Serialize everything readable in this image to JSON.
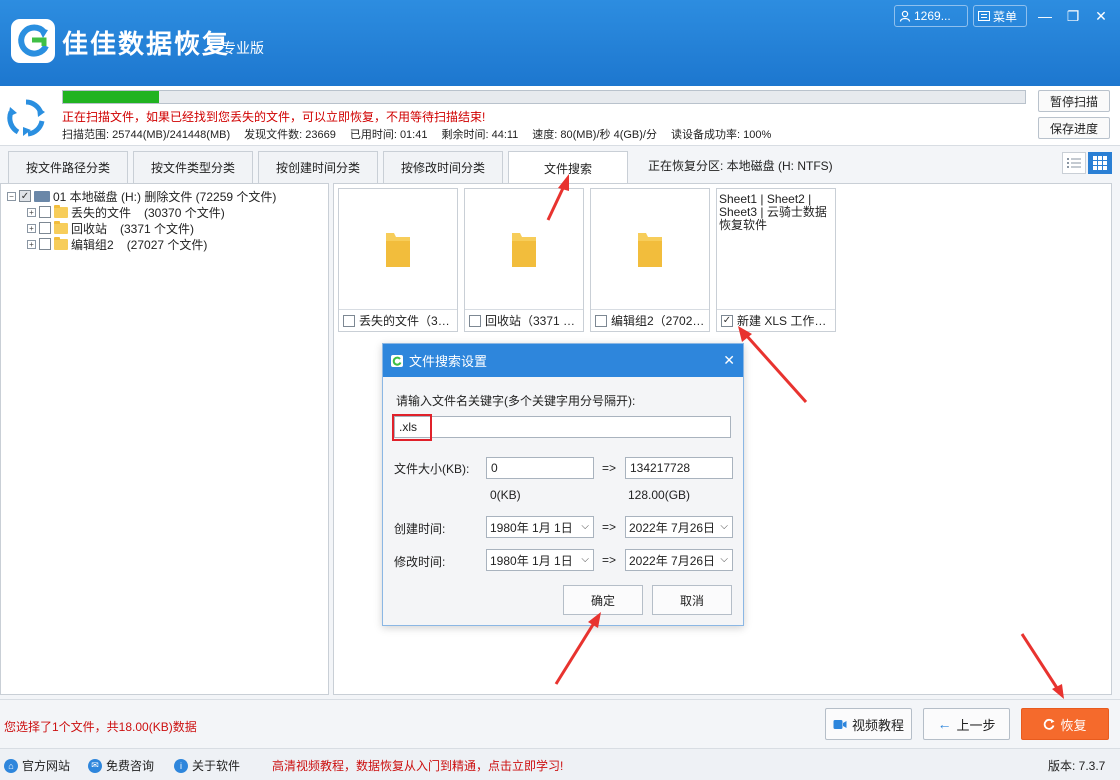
{
  "app": {
    "title": "佳佳数据恢复",
    "edition": "专业版"
  },
  "titlebar": {
    "user": "1269...",
    "menu": "菜单"
  },
  "scan": {
    "progress": 0.1,
    "message": "正在扫描文件，如果已经找到您丢失的文件，可以立即恢复，不用等待扫描结束!",
    "range": "扫描范围: 25744(MB)/241448(MB)",
    "found": "发现文件数: 23669",
    "elapsed": "已用时间: 01:41",
    "remaining": "剩余时间: 44:11",
    "speed": "速度: 80(MB)/秒  4(GB)/分",
    "read_rate": "读设备成功率: 100%",
    "pause_button": "暂停扫描",
    "save_button": "保存进度"
  },
  "tabs": [
    {
      "label": "按文件路径分类"
    },
    {
      "label": "按文件类型分类"
    },
    {
      "label": "按创建时间分类"
    },
    {
      "label": "按修改时间分类"
    },
    {
      "label": "文件搜索"
    }
  ],
  "partition_label": "正在恢复分区: 本地磁盘 (H: NTFS)",
  "tree": {
    "root": "01 本地磁盘 (H:) 删除文件   (72259 个文件)",
    "items": [
      {
        "name": "丢失的文件",
        "count": "(30370 个文件)"
      },
      {
        "name": "回收站",
        "count": "(3371 个文件)"
      },
      {
        "name": "编辑组2",
        "count": "(27027 个文件)"
      }
    ]
  },
  "cards": [
    {
      "label": "丢失的文件（30...",
      "checked": false
    },
    {
      "label": "回收站（3371 个...",
      "checked": false
    },
    {
      "label": "编辑组2（27027 ...",
      "checked": false
    },
    {
      "label": "新建 XLS 工作表...",
      "checked": true,
      "preview": "Sheet1 | Sheet2 | Sheet3 | 云骑士数据恢复软件"
    }
  ],
  "dialog": {
    "title": "文件搜索设置",
    "keyword_label": "请输入文件名关键字(多个关键字用分号隔开):",
    "keyword_value": ".xls",
    "size_label": "文件大小(KB):",
    "size_min": "0",
    "size_max": "134217728",
    "size_min_hint": "0(KB)",
    "size_max_hint": "128.00(GB)",
    "arrow": "=>",
    "create_label": "创建时间:",
    "create_from": "1980年  1月  1日",
    "create_to": "2022年  7月26日",
    "modify_label": "修改时间:",
    "modify_from": "1980年  1月  1日",
    "modify_to": "2022年  7月26日",
    "ok": "确定",
    "cancel": "取消"
  },
  "footer": {
    "selection": "您选择了1个文件，共18.00(KB)数据",
    "video_tutorial": "视频教程",
    "prev": "上一步",
    "recover": "恢复"
  },
  "status": {
    "website": "官方网站",
    "consult": "免费咨询",
    "about": "关于软件",
    "promo": "高清视频教程，数据恢复从入门到精通，点击立即学习!",
    "version": "版本: 7.3.7"
  },
  "colors": {
    "title_bar": "#1d77cf",
    "progress": "#21b321",
    "recover_button": "#f56a2c",
    "alert_text": "#cc1010"
  }
}
